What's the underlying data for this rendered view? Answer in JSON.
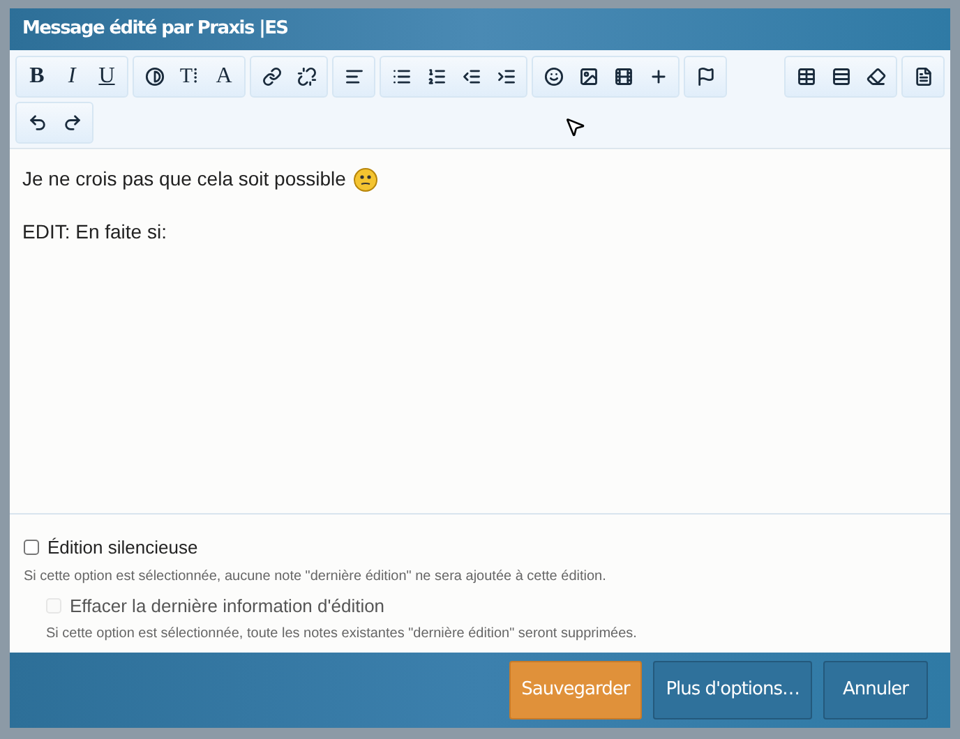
{
  "dialog": {
    "title": "Message édité par Praxis |ES"
  },
  "toolbar": {
    "text_glyphs": [
      "B",
      "I",
      "U"
    ],
    "size_glyph": "T⁞",
    "color_glyph": "A"
  },
  "editor": {
    "paragraphs": [
      "Je ne crois pas que cela soit possible",
      "EDIT: En faite si:"
    ]
  },
  "options": [
    {
      "label": "Édition silencieuse",
      "checked": false,
      "disabled": false,
      "indented": false,
      "hint": "Si cette option est sélectionnée, aucune note \"dernière édition\" ne sera ajoutée à cette édition."
    },
    {
      "label": "Effacer la dernière information d'édition",
      "checked": false,
      "disabled": true,
      "indented": true,
      "hint": "Si cette option est sélectionnée, toute les notes existantes \"dernière édition\" seront supprimées."
    }
  ],
  "buttons": [
    {
      "label": "Sauvegarder",
      "kind": "primary"
    },
    {
      "label": "Plus d'options…",
      "kind": "secondary"
    },
    {
      "label": "Annuler",
      "kind": "secondary"
    }
  ]
}
